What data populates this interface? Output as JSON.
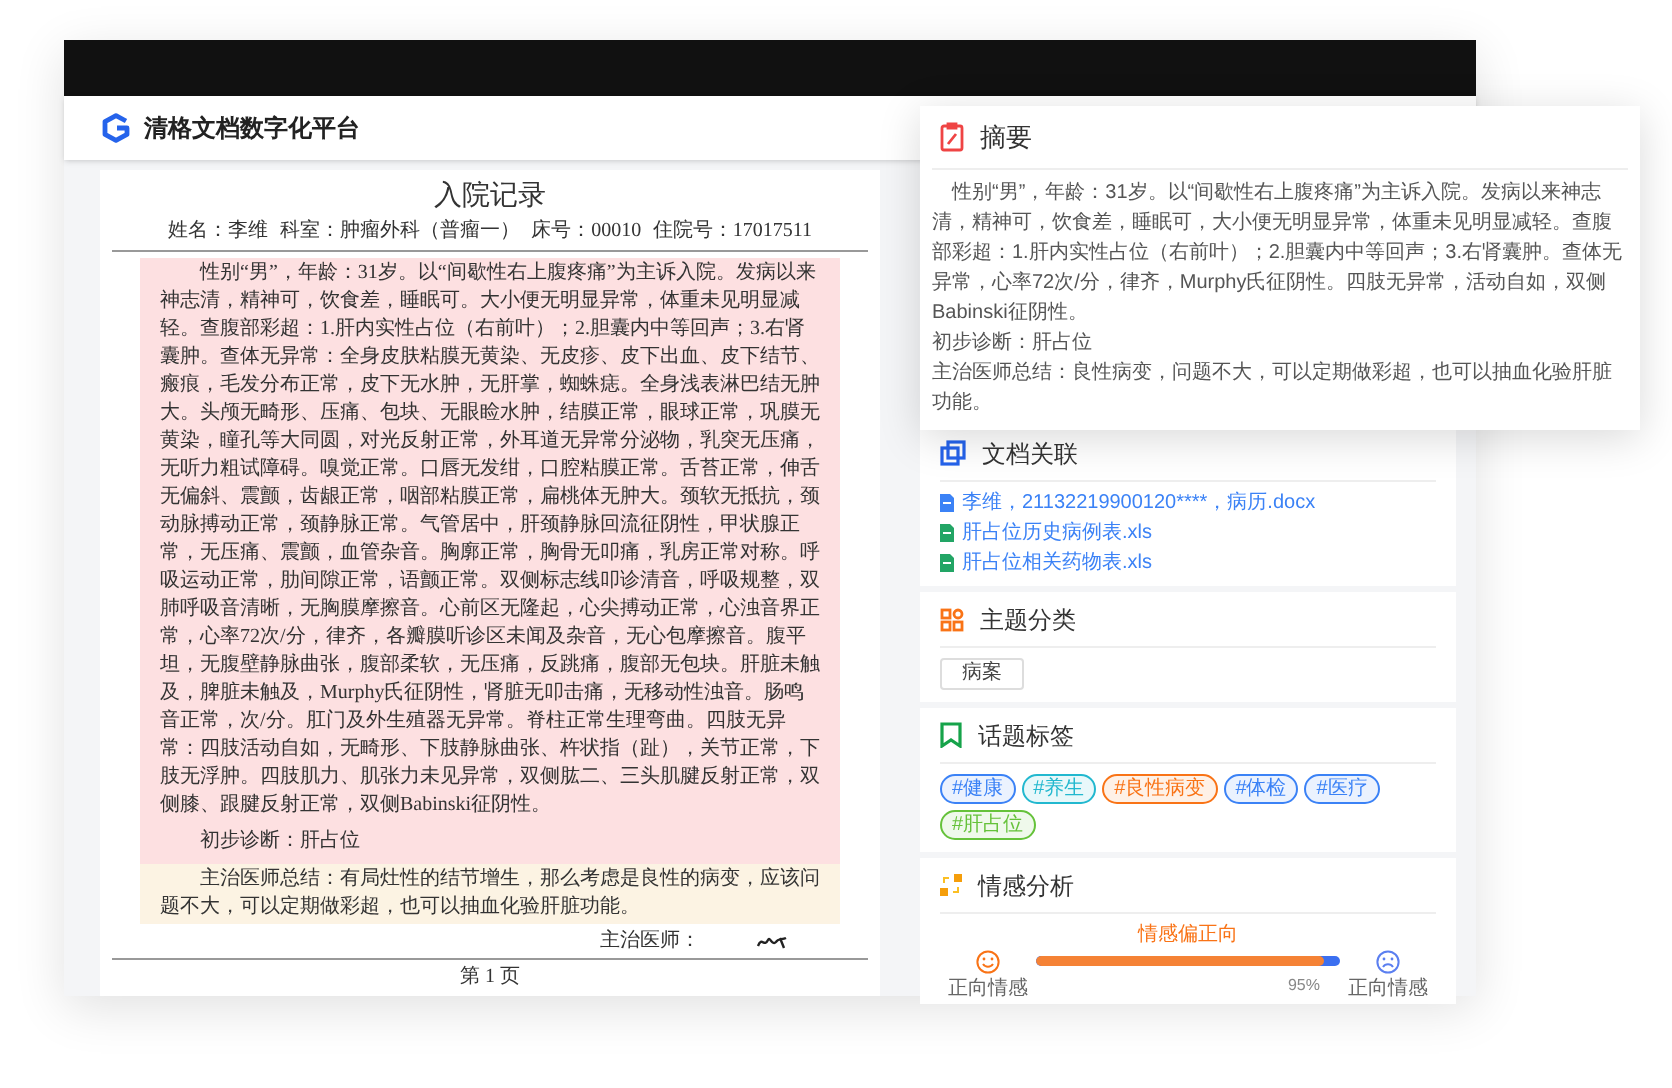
{
  "app": {
    "title": "清格文档数字化平台"
  },
  "document": {
    "title": "入院记录",
    "info": [
      "姓名：李维",
      "科室：肿瘤外科（普瘤一）",
      "床号：00010",
      "住院号：17017511"
    ],
    "findings": "性别“男”，年龄：31岁。以“间歇性右上腹疼痛”为主诉入院。发病以来神志清，精神可，饮食差，睡眠可。大小便无明显异常，体重未见明显减轻。查腹部彩超：1.肝内实性占位（右前叶）；2.胆囊内中等回声；3.右肾囊肿。查体无异常：全身皮肤粘膜无黄染、无皮疹、皮下出血、皮下结节、瘢痕，毛发分布正常，皮下无水肿，无肝掌，蜘蛛痣。全身浅表淋巴结无肿大。头颅无畸形、压痛、包块、无眼睑水肿，结膜正常，眼球正常，巩膜无黄染，瞳孔等大同圆，对光反射正常，外耳道无异常分泌物，乳突无压痛，无听力粗试障碍。嗅觉正常。口唇无发绀，口腔粘膜正常。舌苔正常，伸舌无偏斜、震颤，齿龈正常，咽部粘膜正常，扁桃体无肿大。颈软无抵抗，颈动脉搏动正常，颈静脉正常。气管居中，肝颈静脉回流征阴性，甲状腺正常，无压痛、震颤，血管杂音。胸廓正常，胸骨无叩痛，乳房正常对称。呼吸运动正常，肋间隙正常，语颤正常。双侧标志线叩诊清音，呼吸规整，双肺呼吸音清晰，无胸膜摩擦音。心前区无隆起，心尖搏动正常，心浊音界正常，心率72次/分，律齐，各瓣膜听诊区未闻及杂音，无心包摩擦音。腹平坦，无腹壁静脉曲张，腹部柔软，无压痛，反跳痛，腹部无包块。肝脏未触及，脾脏未触及，Murphy氏征阴性，肾脏无叩击痛，无移动性浊音。肠鸣音正常，次/分。肛门及外生殖器无异常。脊柱正常生理弯曲。四肢无异常：四肢活动自如，无畸形、下肢静脉曲张、杵状指（趾），关节正常，下肢无浮肿。四肢肌力、肌张力未见异常，双侧肱二、三头肌腱反射正常，双侧膝、跟腱反射正常，双侧Babinski征阴性。",
    "diagnosis": "初步诊断：肝占位",
    "summary": "主治医师总结：有局灶性的结节增生，那么考虑是良性的病变，应该问题不大，可以定期做彩超，也可以抽血化验肝脏功能。",
    "signature_label": "主治医师：",
    "page": "第 1 页"
  },
  "abstract": {
    "title": "摘要",
    "lines": [
      "性别“男”，年龄：31岁。以“间歇性右上腹疼痛”为主诉入院。发病以来神志清，精神可，饮食差，睡眠可，大小便无明显异常，体重未见明显减轻。查腹部彩超：1.肝内实性占位（右前叶）；2.胆囊内中等回声；3.右肾囊肿。查体无异常，心率72次/分，律齐，Murphy氏征阴性。四肢无异常，活动自如，双侧Babinski征阴性。",
      "初步诊断：肝占位",
      "主治医师总结：良性病变，问题不大，可以定期做彩超，也可以抽血化验肝脏功能。"
    ]
  },
  "related": {
    "title": "文档关联",
    "files": [
      {
        "name": "李维，21132219900120****，病历.docx",
        "kind": "doc"
      },
      {
        "name": "肝占位历史病例表.xls",
        "kind": "sheet"
      },
      {
        "name": "肝占位相关药物表.xls",
        "kind": "sheet"
      }
    ]
  },
  "topics": {
    "title": "主题分类",
    "items": [
      "病案"
    ]
  },
  "tags": {
    "title": "话题标签",
    "items": [
      {
        "label": "#健康",
        "color": "#3b82f6"
      },
      {
        "label": "#养生",
        "color": "#22b8cf"
      },
      {
        "label": "#良性病变",
        "color": "#f97316"
      },
      {
        "label": "#体检",
        "color": "#3b82f6"
      },
      {
        "label": "#医疗",
        "color": "#3b82f6"
      },
      {
        "label": "#肝占位",
        "color": "#65c23a"
      }
    ]
  },
  "sentiment": {
    "title": "情感分析",
    "verdict": "情感偏正向",
    "level": 0.95,
    "reading": "95%",
    "positive_label": "正向情感",
    "negative_label": "正向情感"
  }
}
